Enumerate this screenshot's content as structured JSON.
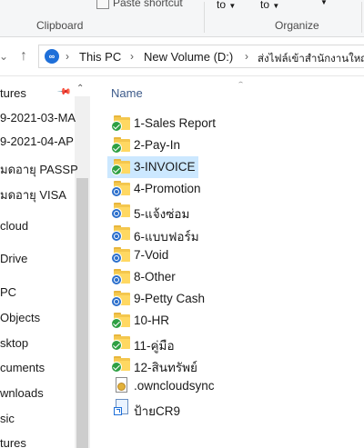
{
  "ribbon": {
    "paste_shortcut": "Paste shortcut",
    "move_to": "to",
    "copy_to": "to",
    "clipboard_group": "Clipboard",
    "organize_group": "Organize"
  },
  "address": {
    "crumbs": [
      "This PC",
      "New Volume (D:)",
      "ส่งไฟล์เข้าสำนักงานใหญ่"
    ]
  },
  "navpane": {
    "items": [
      "tures",
      "9-2021-03-MA",
      "9-2021-04-AP",
      "มดอายุ PASSP",
      "มดอายุ VISA",
      "cloud",
      "Drive",
      "PC",
      "Objects",
      "sktop",
      "cuments",
      "wnloads",
      "sic",
      "tures"
    ]
  },
  "content": {
    "column_name": "Name",
    "files": [
      {
        "name": "1-Sales Report",
        "type": "folder",
        "status": "green"
      },
      {
        "name": "2-Pay-In",
        "type": "folder",
        "status": "green"
      },
      {
        "name": "3-INVOICE",
        "type": "folder",
        "status": "green"
      },
      {
        "name": "4-Promotion",
        "type": "folder",
        "status": "blue"
      },
      {
        "name": "5-แจ้งซ่อม",
        "type": "folder",
        "status": "blue"
      },
      {
        "name": "6-แบบฟอร์ม",
        "type": "folder",
        "status": "blue"
      },
      {
        "name": "7-Void",
        "type": "folder",
        "status": "blue"
      },
      {
        "name": "8-Other",
        "type": "folder",
        "status": "blue"
      },
      {
        "name": "9-Petty Cash",
        "type": "folder",
        "status": "blue"
      },
      {
        "name": "10-HR",
        "type": "folder",
        "status": "green"
      },
      {
        "name": "11-คู่มือ",
        "type": "folder",
        "status": "green"
      },
      {
        "name": "12-สินทรัพย์",
        "type": "folder",
        "status": "green"
      },
      {
        "name": ".owncloudsync",
        "type": "settings-file",
        "status": "none"
      },
      {
        "name": "ป้ายCR9",
        "type": "shortcut",
        "status": "none"
      }
    ],
    "selected_index": 2
  },
  "colors": {
    "selection": "#cce8ff",
    "sync_ok": "#2ea043",
    "sync_pending": "#2b6fcc",
    "folder": "#ffd862"
  }
}
